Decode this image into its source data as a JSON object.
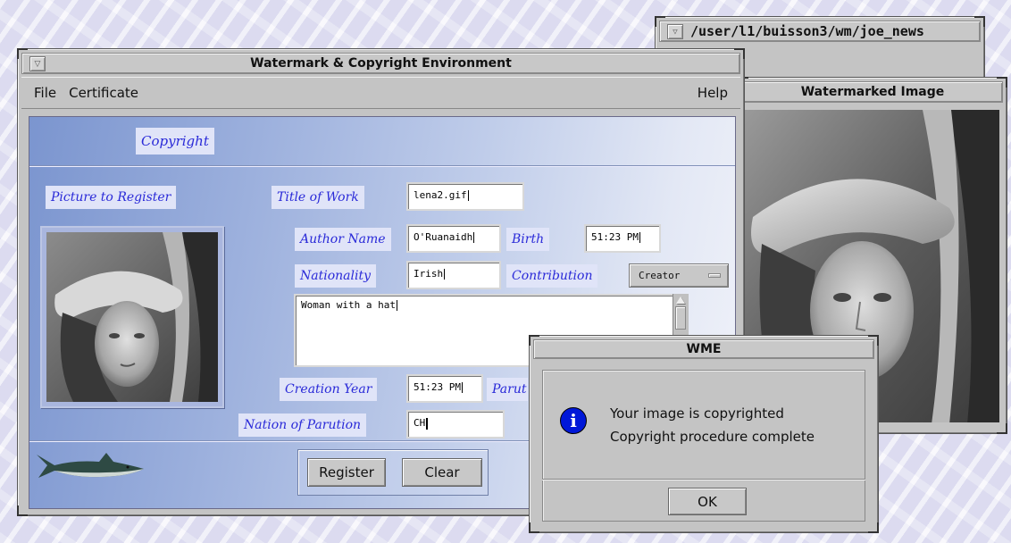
{
  "background_window": {
    "title": "/user/l1/buisson3/wm/joe_news"
  },
  "watermarked_window": {
    "title": "Watermarked Image"
  },
  "main_window": {
    "title": "Watermark & Copyright Environment",
    "menu": {
      "file": "File",
      "certificate": "Certificate",
      "help": "Help"
    },
    "form": {
      "section_title": "Copyright",
      "picture_label": "Picture to Register",
      "title_of_work": {
        "label": "Title of Work",
        "value": "lena2.gif"
      },
      "author_name": {
        "label": "Author Name",
        "value": "O'Ruanaidh"
      },
      "birth": {
        "label": "Birth",
        "value": "51:23 PM"
      },
      "nationality": {
        "label": "Nationality",
        "value": "Irish"
      },
      "contribution": {
        "label": "Contribution",
        "value": "Creator"
      },
      "description": "Woman with a hat",
      "creation_year": {
        "label": "Creation Year",
        "value": "51:23 PM"
      },
      "parution_partial_label": "Parut",
      "nation_of_parution": {
        "label": "Nation of Parution",
        "value": "CH"
      }
    },
    "buttons": {
      "register": "Register",
      "clear": "Clear"
    }
  },
  "dialog": {
    "title": "WME",
    "icon": "info-icon",
    "icon_glyph": "i",
    "line1": "Your image is copyrighted",
    "line2": "Copyright procedure complete",
    "ok": "OK"
  },
  "colors": {
    "label_text": "#2a2ad8",
    "label_bg": "#e0e4f8",
    "info_icon": "#0018d8",
    "window_gray": "#c4c4c4"
  }
}
